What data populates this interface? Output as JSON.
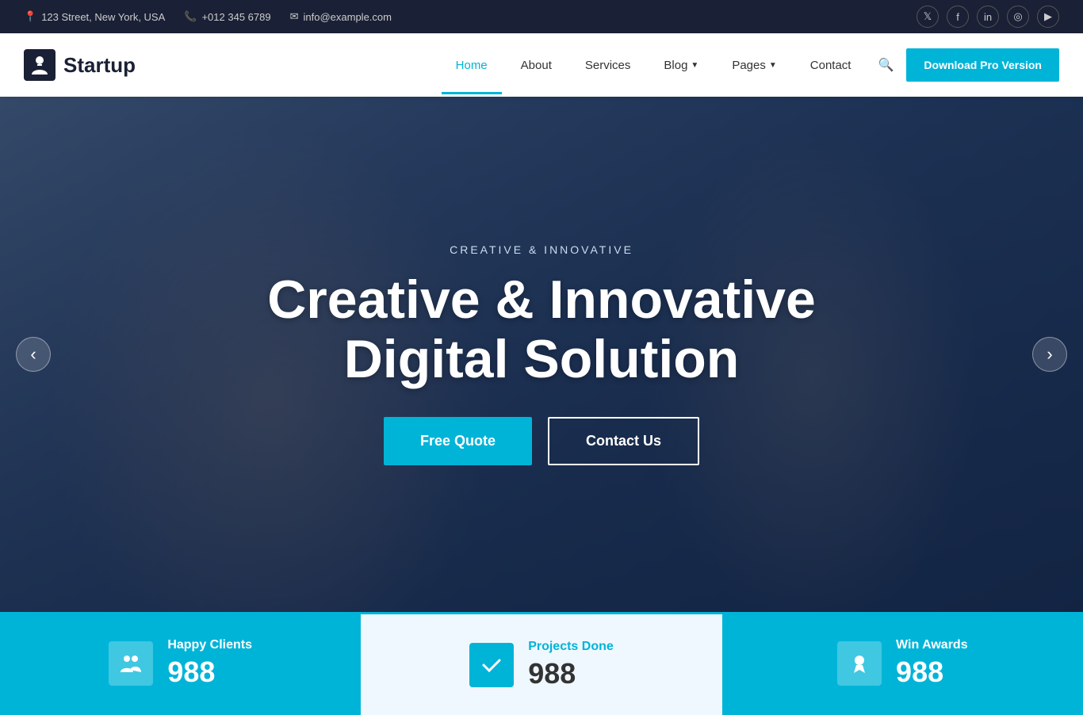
{
  "topbar": {
    "address": "123 Street, New York, USA",
    "phone": "+012 345 6789",
    "email": "info@example.com",
    "address_icon": "📍",
    "phone_icon": "📞",
    "email_icon": "✉"
  },
  "social": [
    {
      "name": "twitter",
      "icon": "𝕏"
    },
    {
      "name": "facebook",
      "icon": "f"
    },
    {
      "name": "linkedin",
      "icon": "in"
    },
    {
      "name": "instagram",
      "icon": "◎"
    },
    {
      "name": "youtube",
      "icon": "▶"
    }
  ],
  "navbar": {
    "logo_text": "Startup",
    "links": [
      {
        "label": "Home",
        "active": true,
        "has_arrow": false
      },
      {
        "label": "About",
        "active": false,
        "has_arrow": false
      },
      {
        "label": "Services",
        "active": false,
        "has_arrow": false
      },
      {
        "label": "Blog",
        "active": false,
        "has_arrow": true
      },
      {
        "label": "Pages",
        "active": false,
        "has_arrow": true
      },
      {
        "label": "Contact",
        "active": false,
        "has_arrow": false
      }
    ],
    "search_icon": "🔍",
    "pro_button": "Download Pro Version"
  },
  "hero": {
    "subtitle": "CREATIVE & INNOVATIVE",
    "title_line1": "Creative & Innovative",
    "title_line2": "Digital Solution",
    "btn_quote": "Free Quote",
    "btn_contact": "Contact Us"
  },
  "stats": [
    {
      "label": "Happy Clients",
      "number": "988",
      "icon": "👥",
      "theme": "blue"
    },
    {
      "label": "Projects Done",
      "number": "988",
      "icon": "✓",
      "theme": "white"
    },
    {
      "label": "Win Awards",
      "number": "988",
      "icon": "🏅",
      "theme": "blue2"
    }
  ]
}
